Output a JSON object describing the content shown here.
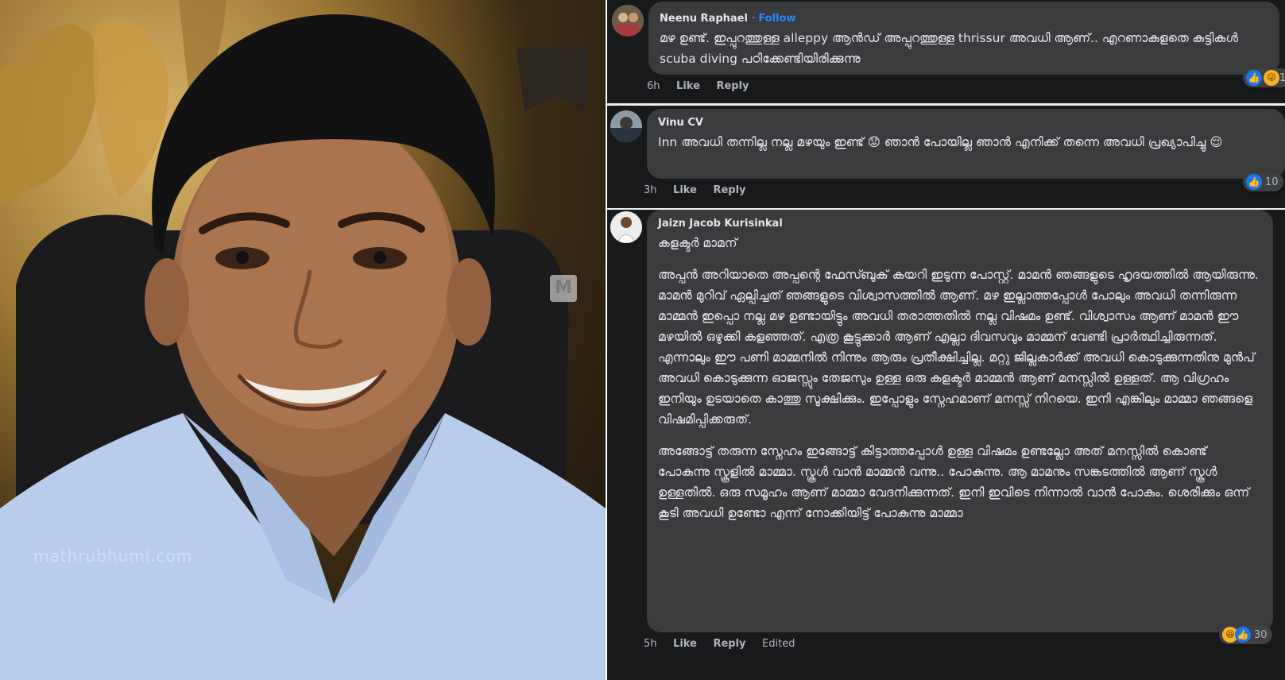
{
  "watermark": {
    "badge": "M",
    "site": "mathrubhumi.com"
  },
  "comments": [
    {
      "author": "Neenu Raphael",
      "follow": "Follow",
      "text": "മഴ ഉണ്ട്. ഇപ്പുറത്തുള്ള alleppy ആൻഡ് അപ്പുറത്തുള്ള thrissur അവധി ആണ്.. എറണാകുളതെ കുട്ടികൾ scuba diving പഠിക്കേണ്ടിയിരിക്കുന്നു",
      "time": "6h",
      "like": "Like",
      "reply": "Reply",
      "reactions": [
        "like-icon",
        "haha-icon"
      ],
      "reaction_count": "1"
    },
    {
      "author": "Vinu CV",
      "text": "Inn അവധി തന്നില്ല നല്ല മഴയും ഇണ്ട് 😟 ഞാൻ പോയില്ല ഞാൻ എനിക്ക് തന്നെ അവധി പ്രഖ്യാപിച്ചു 😌",
      "time": "3h",
      "like": "Like",
      "reply": "Reply",
      "reactions": [
        "like-icon"
      ],
      "reaction_count": "10"
    },
    {
      "author": "Jaizn Jacob Kurisinkal",
      "heading": "കളക്ടർ മാമന്",
      "paragraph1": "അപ്പൻ അറിയാതെ അപ്പന്റെ ഫേസ്ബുക് കയറി ഇടുന്ന പോസ്റ്റ്. മാമൻ ഞങ്ങളുടെ ഹൃദയത്തിൽ ആയിരുന്നു. മാമൻ മുറിവ് ഏല്പിച്ചത് ഞങ്ങളുടെ വിശ്വാസത്തിൽ ആണ്. മഴ ഇല്ലാത്തപ്പോൾ പോലും അവധി തന്നിരുന്ന മാമ്മൻ ഇപ്പൊ നല്ല മഴ ഉണ്ടായിട്ടും അവധി തരാത്തതിൽ നല്ല വിഷമം ഉണ്ട്. വിശ്വാസം ആണ് മാമൻ ഈ മഴയിൽ ഒഴുക്കി കളഞ്ഞത്. എത്ര കൂട്ടുക്കാർ ആണ് എല്ലാ ദിവസവും മാമ്മന് വേണ്ടി പ്രാർത്ഥിച്ചിരുന്നത്. എന്നാലും ഈ പണി മാമ്മനിൽ നിന്നും ആരും പ്രതീക്ഷിച്ചില്ല. മറ്റു ജില്ലകാർക്ക് അവധി കൊടുക്കുന്നതിനു മുൻപ് അവധി കൊടുക്കുന്ന ഓജസ്സും തേജസും ഉള്ള ഒരു കളക്ടർ മാമ്മൻ ആണ് മനസ്സിൽ ഉള്ളത്. ആ വിഗ്രഹം ഇനിയും ഉടയാതെ കാത്തു സൂക്ഷിക്കും. ഇപ്പോളും സ്നേഹമാണ് മനസ്സ് നിറയെ. ഇനി എങ്കിലും മാമ്മാ ഞങ്ങളെ വിഷമിപ്പിക്കരുത്.",
      "paragraph2": "അങ്ങോട്ട് തരുന്ന സ്നേഹം ഇങ്ങോട്ട് കിട്ടാത്തപ്പോൾ ഉള്ള വിഷമം ഉണ്ടല്ലോ അത് മനസ്സിൽ കൊണ്ട് പോകുന്നു സ്കൂളിൽ മാമ്മാ. സ്കൂൾ വാൻ മാമ്മൻ വന്നു.. പോകുന്നു. ആ മാമനും സങ്കടത്തിൽ ആണ് സ്കൂൾ ഉള്ളതിൽ. ഒരു സമൂഹം ആണ് മാമ്മാ വേദനിക്കുന്നത്. ഇനി ഇവിടെ നിന്നാൽ വാൻ പോകും. ശെരിക്കും ഒന്ന് കൂടി അവധി ഉണ്ടോ എന്ന് നോക്കിയിട്ട് പോകുന്നു മാമ്മാ",
      "time": "5h",
      "like": "Like",
      "reply": "Reply",
      "edited": "Edited",
      "reactions": [
        "haha-icon",
        "like-icon"
      ],
      "reaction_count": "30"
    }
  ],
  "colors": {
    "panel_bg": "#18191a",
    "bubble_bg": "#3a3b3c",
    "text": "#e4e6eb",
    "muted": "#b0b3b8",
    "link_blue": "#2d88ff"
  }
}
